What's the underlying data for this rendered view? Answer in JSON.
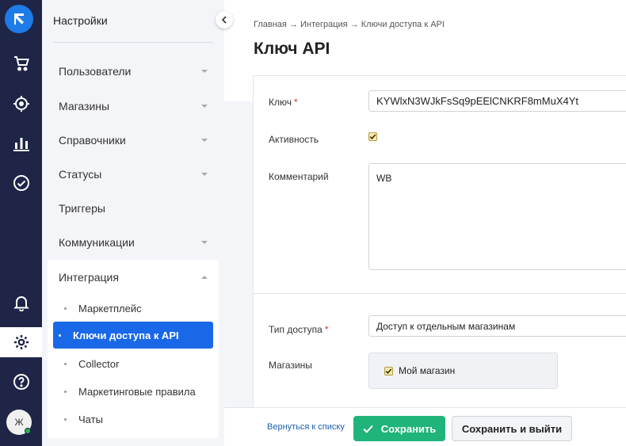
{
  "colors": {
    "rail_bg": "#1f2547",
    "accent_blue": "#1968e8",
    "save_green": "#20b47a",
    "required_red": "#e52b2b"
  },
  "rail": {
    "icons": [
      "logo-icon",
      "cart-icon",
      "target-icon",
      "chart-icon",
      "check-circle-icon",
      "bell-icon",
      "gear-icon",
      "help-icon"
    ],
    "avatar_letter": "Ж"
  },
  "menu": {
    "title": "Настройки",
    "items": [
      {
        "label": "Пользователи",
        "expandable": true
      },
      {
        "label": "Магазины",
        "expandable": true
      },
      {
        "label": "Справочники",
        "expandable": true
      },
      {
        "label": "Статусы",
        "expandable": true
      },
      {
        "label": "Триггеры",
        "expandable": false
      },
      {
        "label": "Коммуникации",
        "expandable": true
      }
    ],
    "group": {
      "label": "Интеграция",
      "subitems": [
        "Маркетплейс",
        "Ключи доступа к API",
        "Collector",
        "Маркетинговые правила",
        "Чаты"
      ],
      "active_index": 1
    }
  },
  "page": {
    "breadcrumb": "Главная → Интеграция → Ключи доступа к API",
    "title": "Ключ API"
  },
  "form": {
    "key_label": "Ключ",
    "key_value": "KYWlxN3WJkFsSq9pEElCNKRF8mMuX4Yt",
    "active_label": "Активность",
    "active_checked": true,
    "comment_label": "Комментарий",
    "comment_value": "WB",
    "access_label": "Тип доступа",
    "access_value": "Доступ к отдельным магазинам",
    "shops_label": "Магазины",
    "shop_option": "Мой магазин",
    "shop_checked": true
  },
  "footer": {
    "back_link": "Вернуться к списку",
    "save_label": "Сохранить",
    "save_exit_label": "Сохранить и выйти"
  }
}
